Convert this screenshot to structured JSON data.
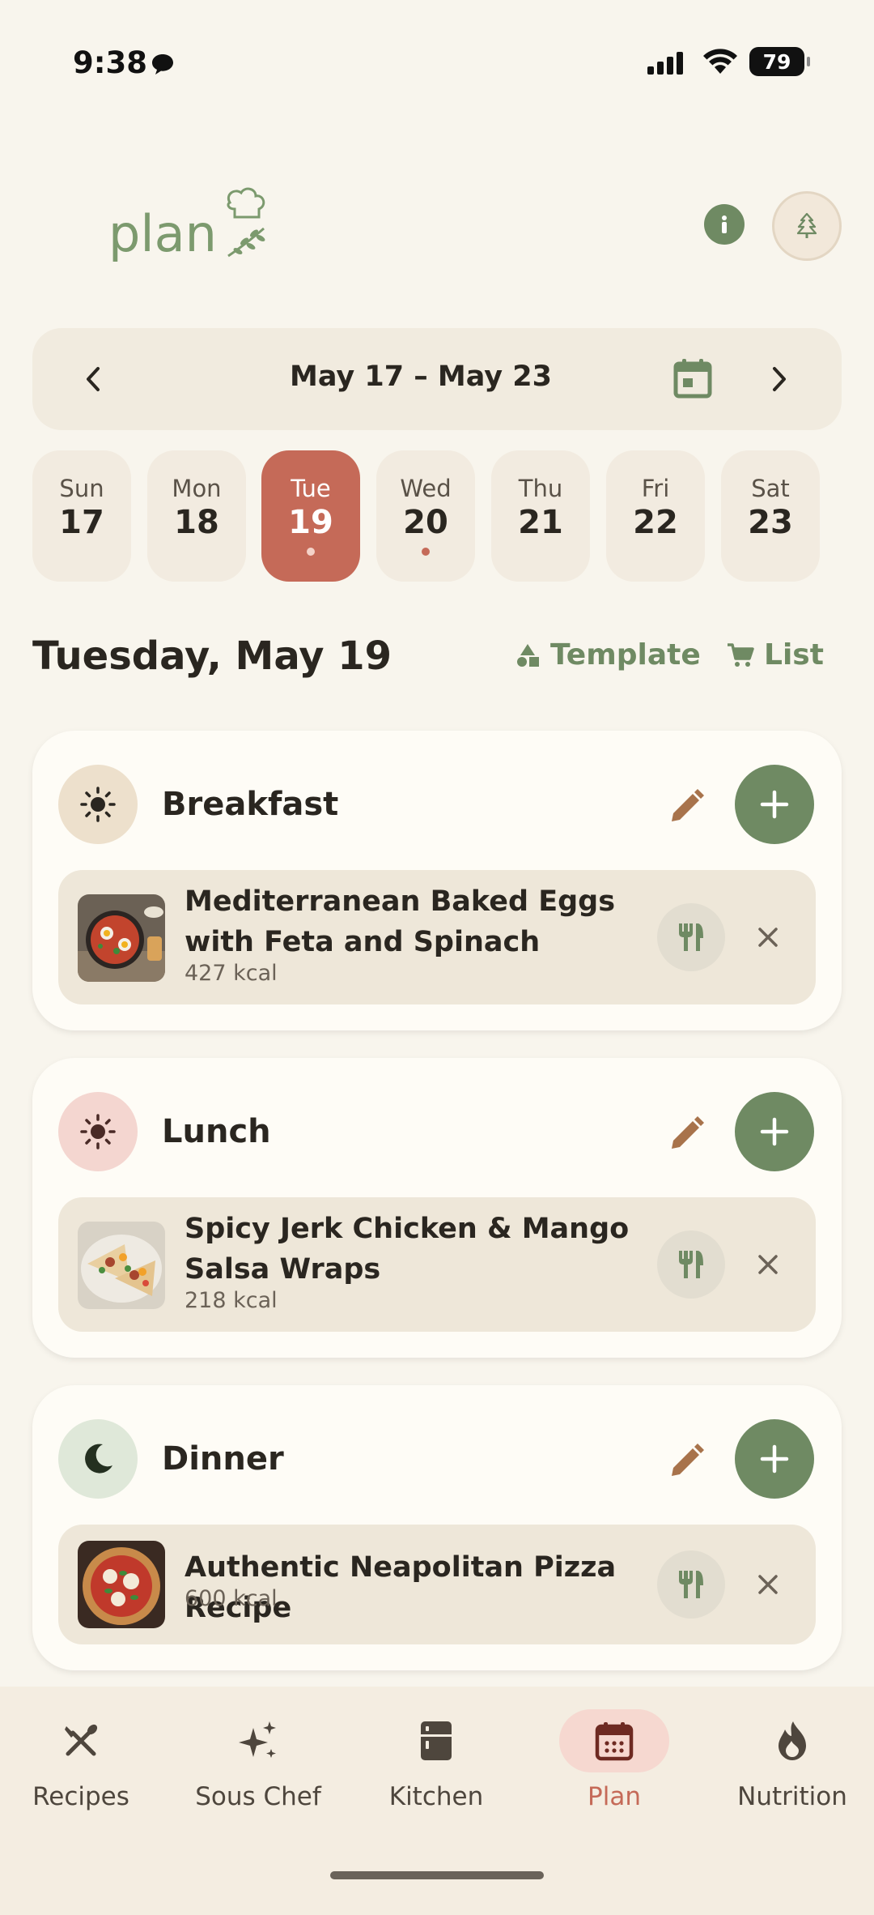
{
  "status_bar": {
    "time": "9:38",
    "battery": "79"
  },
  "header": {
    "logo_text": "plan",
    "info_icon": "info-icon",
    "avatar_icon": "tree-icon"
  },
  "week": {
    "range": "May 17 – May 23"
  },
  "days": [
    {
      "name": "Sun",
      "num": "17",
      "selected": false,
      "dot": false
    },
    {
      "name": "Mon",
      "num": "18",
      "selected": false,
      "dot": false
    },
    {
      "name": "Tue",
      "num": "19",
      "selected": true,
      "dot": true
    },
    {
      "name": "Wed",
      "num": "20",
      "selected": false,
      "dot": true
    },
    {
      "name": "Thu",
      "num": "21",
      "selected": false,
      "dot": false
    },
    {
      "name": "Fri",
      "num": "22",
      "selected": false,
      "dot": false
    },
    {
      "name": "Sat",
      "num": "23",
      "selected": false,
      "dot": false
    }
  ],
  "selected_date": "Tuesday, May 19",
  "actions": {
    "template_label": "Template",
    "list_label": "List"
  },
  "meals": [
    {
      "title": "Breakfast",
      "icon": "sun-icon",
      "recipe": {
        "name": "Mediterranean Baked Eggs with Feta and Spinach",
        "kcal": "427 kcal"
      }
    },
    {
      "title": "Lunch",
      "icon": "sun-icon",
      "recipe": {
        "name": "Spicy Jerk Chicken & Mango Salsa Wraps",
        "kcal": "218 kcal"
      }
    },
    {
      "title": "Dinner",
      "icon": "moon-icon",
      "recipe": {
        "name": "Authentic Neapolitan Pizza Recipe",
        "kcal": "600 kcal"
      }
    }
  ],
  "nav": [
    {
      "label": "Recipes",
      "icon": "utensils-cross-icon"
    },
    {
      "label": "Sous Chef",
      "icon": "sparkles-icon"
    },
    {
      "label": "Kitchen",
      "icon": "fridge-icon"
    },
    {
      "label": "Plan",
      "icon": "calendar-icon",
      "active": true
    },
    {
      "label": "Nutrition",
      "icon": "flame-icon"
    }
  ],
  "colors": {
    "accent": "#c56a58",
    "green": "#6f8a63",
    "background": "#f8f5ed",
    "card": "#fefcf6"
  }
}
